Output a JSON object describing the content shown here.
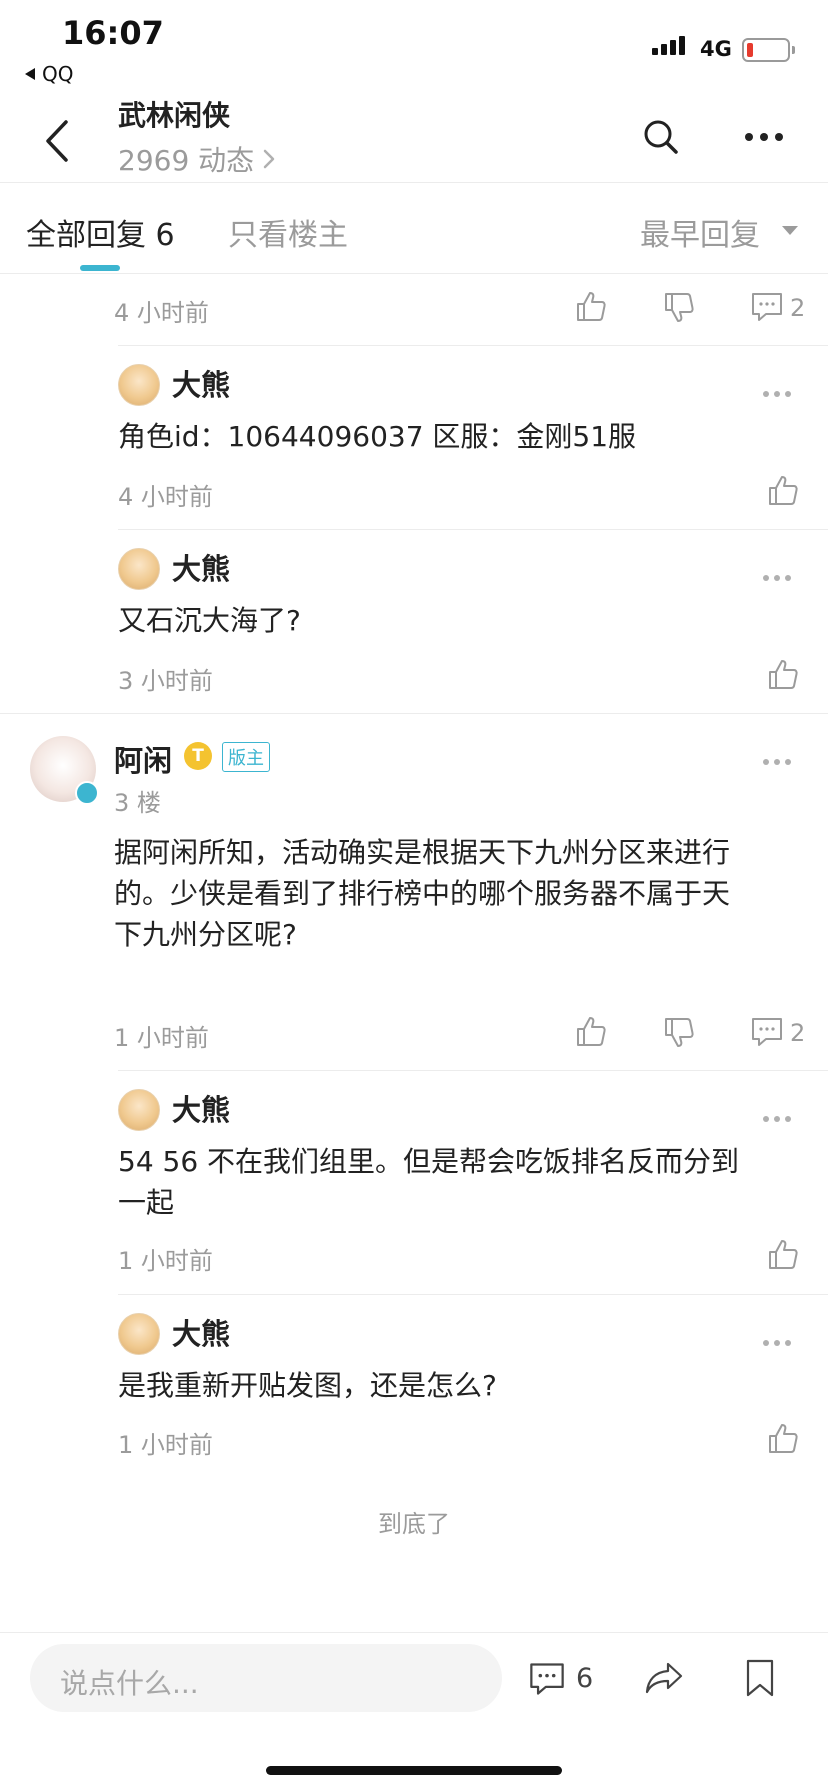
{
  "status_bar": {
    "time": "16:07",
    "back_app": "QQ",
    "network": "4G"
  },
  "nav": {
    "title": "武林闲侠",
    "subtitle": "2969 动态"
  },
  "tabs": {
    "all": "全部回复 6",
    "owner_only": "只看楼主",
    "sort": "最早回复"
  },
  "thread": {
    "top_reply_meta": {
      "time": "4 小时前",
      "comment_count": "2"
    },
    "sub_replies_1": [
      {
        "author": "大熊",
        "text": "角色id：10644096037  区服：金刚51服",
        "time": "4 小时前"
      },
      {
        "author": "大熊",
        "text": "又石沉大海了?",
        "time": "3 小时前"
      }
    ],
    "floor3": {
      "author": "阿闲",
      "gold_badge": "T",
      "role_badge": "版主",
      "floor": "3 楼",
      "text_line1": "据阿闲所知，活动确实是根据天下九州分区来进行",
      "text_line2": "的。少侠是看到了排行榜中的哪个服务器不属于天",
      "text_line3": "下九州分区呢?",
      "time": "1 小时前",
      "comment_count": "2"
    },
    "sub_replies_2": [
      {
        "author": "大熊",
        "text_line1": "54 56 不在我们组里。但是帮会吃饭排名反而分到",
        "text_line2": "一起",
        "time": "1 小时前"
      },
      {
        "author": "大熊",
        "text": "是我重新开贴发图，还是怎么?",
        "time": "1 小时前"
      }
    ]
  },
  "end_text": "到底了",
  "bottom_bar": {
    "input_placeholder": "说点什么...",
    "comment_count": "6"
  },
  "colors": {
    "accent": "#3cb5d0",
    "muted": "#9b9b9b",
    "gold": "#f4c330",
    "battery_low": "#e63b2e"
  }
}
